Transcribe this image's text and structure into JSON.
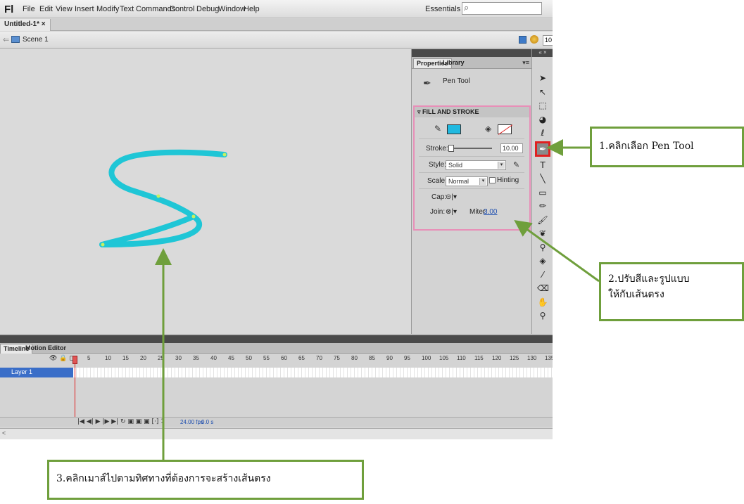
{
  "app": {
    "logo": "Fl",
    "menus": [
      "File",
      "Edit",
      "View",
      "Insert",
      "Modify",
      "Text",
      "Commands",
      "Control",
      "Debug",
      "Window",
      "Help"
    ],
    "workspace": "Essentials ▾",
    "search_placeholder": ""
  },
  "document": {
    "tab_label": "Untitled-1* ×"
  },
  "scenebar": {
    "back_arrow": "⇐",
    "scene_label": "Scene 1",
    "zoom": "10"
  },
  "properties": {
    "tabs": [
      "Properties",
      "Library"
    ],
    "panel_menu": "▾≡",
    "tool_name": "Pen Tool",
    "section_title": "FILL AND STROKE",
    "stroke_label": "Stroke:",
    "stroke_value": "10.00",
    "style_label": "Style:",
    "style_value": "Solid",
    "scale_label": "Scale:",
    "scale_value": "Normal",
    "hinting_label": "Hinting",
    "cap_label": "Cap:",
    "cap_value": "⊝|▾",
    "join_label": "Join:",
    "join_value": "⊗|▾",
    "miter_label": "Miter:",
    "miter_value": "3.00",
    "colors": {
      "stroke": "#20b9e0",
      "fill": "#ffffff",
      "highlight": "#e88fb8"
    }
  },
  "tools": {
    "ctrl": "« ×",
    "icons": [
      "selection-arrow-icon",
      "subselection-icon",
      "free-transform-icon",
      "3d-rotation-icon",
      "lasso-icon",
      "pen-icon",
      "text-icon",
      "line-icon",
      "rectangle-icon",
      "pencil-icon",
      "brush-icon",
      "deco-icon",
      "bone-icon",
      "paint-bucket-icon",
      "eyedropper-icon",
      "eraser-icon",
      "hand-icon",
      "zoom-icon"
    ]
  },
  "timeline": {
    "tabs": [
      "Timeline",
      "Motion Editor"
    ],
    "layer_name": "Layer 1",
    "layer_icons": "👁 🔒 ▢",
    "frame_numbers": [
      "1",
      "5",
      "10",
      "15",
      "20",
      "25",
      "30",
      "35",
      "40",
      "45",
      "50",
      "55",
      "60",
      "65",
      "70",
      "75",
      "80",
      "85",
      "90",
      "95",
      "100",
      "105",
      "110",
      "115",
      "120",
      "125",
      "130",
      "135"
    ],
    "playback": "|◀ ◀| ▶ |▶ ▶|  ↻ ▣ ▣ ▣ [·] 1",
    "fps": "24.00 fps",
    "seconds": "0.0 s"
  },
  "callouts": {
    "one": "1.คลิกเลือก Pen Tool",
    "two_line1": "2.ปรับสีและรูปแบบ",
    "two_line2": "ให้กับเส้นตรง",
    "three": "3.คลิกเมาส์ไปตามทิศทางที่ต้องการจะสร้างเส้นตรง"
  },
  "scroll": {
    "left": "<"
  }
}
